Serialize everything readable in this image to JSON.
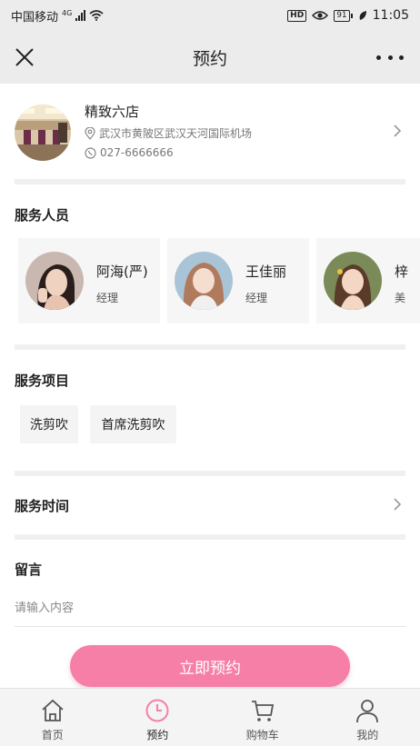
{
  "status_bar": {
    "carrier": "中国移动",
    "network": "4G",
    "battery": "91",
    "time": "11:05"
  },
  "nav": {
    "title": "预约",
    "close_icon": "close-icon",
    "more_icon": "more-icon"
  },
  "store": {
    "name": "精致六店",
    "address": "武汉市黄陂区武汉天河国际机场",
    "phone": "027-6666666"
  },
  "staff_section": {
    "title": "服务人员",
    "members": [
      {
        "name": "阿海(严)",
        "role": "经理"
      },
      {
        "name": "王佳丽",
        "role": "经理"
      },
      {
        "name": "梓",
        "role": "美"
      }
    ]
  },
  "services_section": {
    "title": "服务项目",
    "items": [
      "洗剪吹",
      "首席洗剪吹"
    ]
  },
  "time_section": {
    "title": "服务时间"
  },
  "message_section": {
    "title": "留言",
    "placeholder": "请输入内容"
  },
  "book_button": "立即预约",
  "tab_bar": {
    "active": "预约",
    "items": [
      {
        "label": "首页",
        "icon": "home-icon"
      },
      {
        "label": "预约",
        "icon": "clock-icon"
      },
      {
        "label": "购物车",
        "icon": "cart-icon"
      },
      {
        "label": "我的",
        "icon": "user-icon"
      }
    ]
  },
  "colors": {
    "accent": "#f67fa8",
    "nav_background": "#ececec",
    "divider": "#f0f0f0"
  }
}
